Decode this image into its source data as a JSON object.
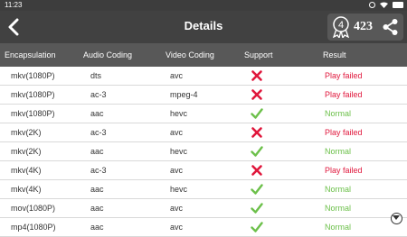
{
  "status_bar": {
    "time": "11:23"
  },
  "app_bar": {
    "title": "Details",
    "badge_digit": "4",
    "badge_count": "423"
  },
  "table": {
    "headers": [
      "Encapsulation",
      "Audio Coding",
      "Video Coding",
      "Support",
      "Result"
    ],
    "rows": [
      {
        "encapsulation": "mkv(1080P)",
        "audio": "dts",
        "video": "avc",
        "support": "cross",
        "result": "Play failed"
      },
      {
        "encapsulation": "mkv(1080P)",
        "audio": "ac-3",
        "video": "mpeg-4",
        "support": "cross",
        "result": "Play failed"
      },
      {
        "encapsulation": "mkv(1080P)",
        "audio": "aac",
        "video": "hevc",
        "support": "check",
        "result": "Normal"
      },
      {
        "encapsulation": "mkv(2K)",
        "audio": "ac-3",
        "video": "avc",
        "support": "cross",
        "result": "Play failed"
      },
      {
        "encapsulation": "mkv(2K)",
        "audio": "aac",
        "video": "hevc",
        "support": "check",
        "result": "Normal"
      },
      {
        "encapsulation": "mkv(4K)",
        "audio": "ac-3",
        "video": "avc",
        "support": "cross",
        "result": "Play failed"
      },
      {
        "encapsulation": "mkv(4K)",
        "audio": "aac",
        "video": "hevc",
        "support": "check",
        "result": "Normal"
      },
      {
        "encapsulation": "mov(1080P)",
        "audio": "aac",
        "video": "avc",
        "support": "check",
        "result": "Normal"
      },
      {
        "encapsulation": "mp4(1080P)",
        "audio": "aac",
        "video": "avc",
        "support": "check",
        "result": "Normal"
      }
    ]
  },
  "colors": {
    "failed": "#e0173c",
    "normal": "#6cc04a",
    "header_bg": "#585858",
    "appbar_bg": "#414141"
  },
  "icons": {
    "back": "chevron-left-icon",
    "award": "award-ribbon-icon",
    "share": "share-icon",
    "cross": "red-cross-icon",
    "check": "green-check-icon",
    "scroll": "chevron-down-circle-icon"
  }
}
